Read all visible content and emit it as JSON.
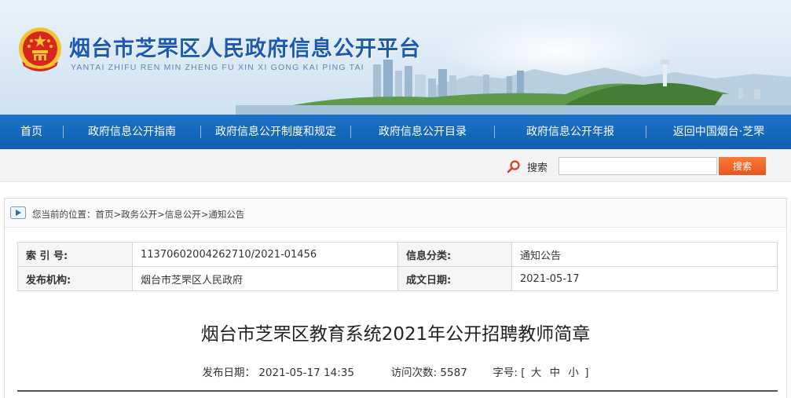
{
  "header": {
    "title": "烟台市芝罘区人民政府信息公开平台",
    "pinyin": "YANTAI ZHIFU REN MIN ZHENG FU XIN XI GONG KAI PING TAI"
  },
  "nav": {
    "items": [
      {
        "label": "首页"
      },
      {
        "label": "政府信息公开指南"
      },
      {
        "label": "政府信息公开制度和规定"
      },
      {
        "label": "政府信息公开目录"
      },
      {
        "label": "政府信息公开年报"
      },
      {
        "label": "返回中国烟台·芝罘"
      }
    ]
  },
  "search": {
    "label": "搜索",
    "placeholder": "",
    "value": "",
    "button_label": "搜索"
  },
  "breadcrumb": {
    "text": "您当前的位置：首页>政务公开>信息公开>通知公告"
  },
  "meta": {
    "index_label": "索 引 号:",
    "index_value": "11370602004262710/2021-01456",
    "category_label": "信息分类:",
    "category_value": "通知公告",
    "publisher_label": "发布机构:",
    "publisher_value": "烟台市芝罘区人民政府",
    "date_label": "成文日期:",
    "date_value": "2021-05-17"
  },
  "article": {
    "title": "烟台市芝罘区教育系统2021年公开招聘教师简章",
    "publish_label": "发布日期：",
    "publish_value": "2021-05-17 14:35",
    "visits_label": "访问次数:",
    "visits_value": "5587",
    "fontsize_label": "字号:",
    "fontsize_open": "[",
    "fontsize_large": "大",
    "fontsize_medium": "中",
    "fontsize_small": "小",
    "fontsize_close": "]"
  },
  "colors": {
    "nav_blue": "#1466be",
    "title_blue": "#1a5ab0",
    "search_orange": "#ef6526",
    "emblem_red": "#d9251d",
    "emblem_gold": "#f4c430"
  }
}
